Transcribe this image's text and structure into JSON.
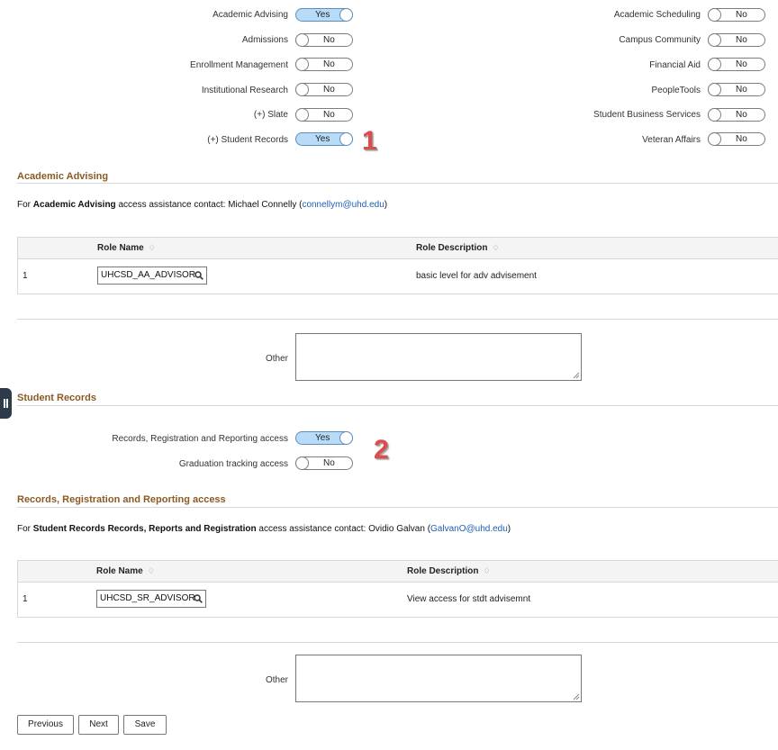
{
  "top_toggles": {
    "left": [
      {
        "label": "Academic Advising",
        "value": "Yes"
      },
      {
        "label": "Admissions",
        "value": "No"
      },
      {
        "label": "Enrollment Management",
        "value": "No"
      },
      {
        "label": "Institutional Research",
        "value": "No"
      },
      {
        "label": "(+) Slate",
        "value": "No"
      },
      {
        "label": "(+) Student Records",
        "value": "Yes"
      }
    ],
    "right": [
      {
        "label": "Academic Scheduling",
        "value": "No"
      },
      {
        "label": "Campus Community",
        "value": "No"
      },
      {
        "label": "Financial Aid",
        "value": "No"
      },
      {
        "label": "PeopleTools",
        "value": "No"
      },
      {
        "label": "Student Business Services",
        "value": "No"
      },
      {
        "label": "Veteran Affairs",
        "value": "No"
      }
    ]
  },
  "annotations": {
    "one": "1",
    "two": "2"
  },
  "academic_advising": {
    "title": "Academic Advising",
    "contact_prefix": "For ",
    "contact_bold": "Academic Advising",
    "contact_middle": " access assistance contact: Michael Connelly  (",
    "contact_email": "connellym@uhd.edu",
    "contact_suffix": ")",
    "table": {
      "col_role": "Role Name",
      "col_desc": "Role Description",
      "rows": [
        {
          "num": "1",
          "role": "UHCSD_AA_ADVISOR",
          "desc": "basic level for adv advisement"
        }
      ]
    },
    "other_label": "Other",
    "other_value": ""
  },
  "student_records": {
    "title": "Student Records",
    "toggles": [
      {
        "label": "Records, Registration and Reporting access",
        "value": "Yes"
      },
      {
        "label": "Graduation tracking access",
        "value": "No"
      }
    ]
  },
  "rrr_access": {
    "title": "Records, Registration and Reporting access",
    "contact_prefix": "For ",
    "contact_bold": "Student Records Records, Reports and Registration",
    "contact_middle": " access assistance contact: Ovidio Galvan (",
    "contact_email": "GalvanO@uhd.edu",
    "contact_suffix": ")",
    "table": {
      "col_role": "Role Name",
      "col_desc": "Role Description",
      "rows": [
        {
          "num": "1",
          "role": "UHCSD_SR_ADVISOR",
          "desc": "View access for stdt advisemnt"
        }
      ]
    },
    "other_label": "Other",
    "other_value": ""
  },
  "buttons": {
    "previous": "Previous",
    "next": "Next",
    "save": "Save"
  },
  "colors": {
    "section_title": "#8a5a24",
    "toggle_on": "#b8dcf8",
    "link": "#1f5fb4",
    "annotation": "#e04b4b"
  }
}
